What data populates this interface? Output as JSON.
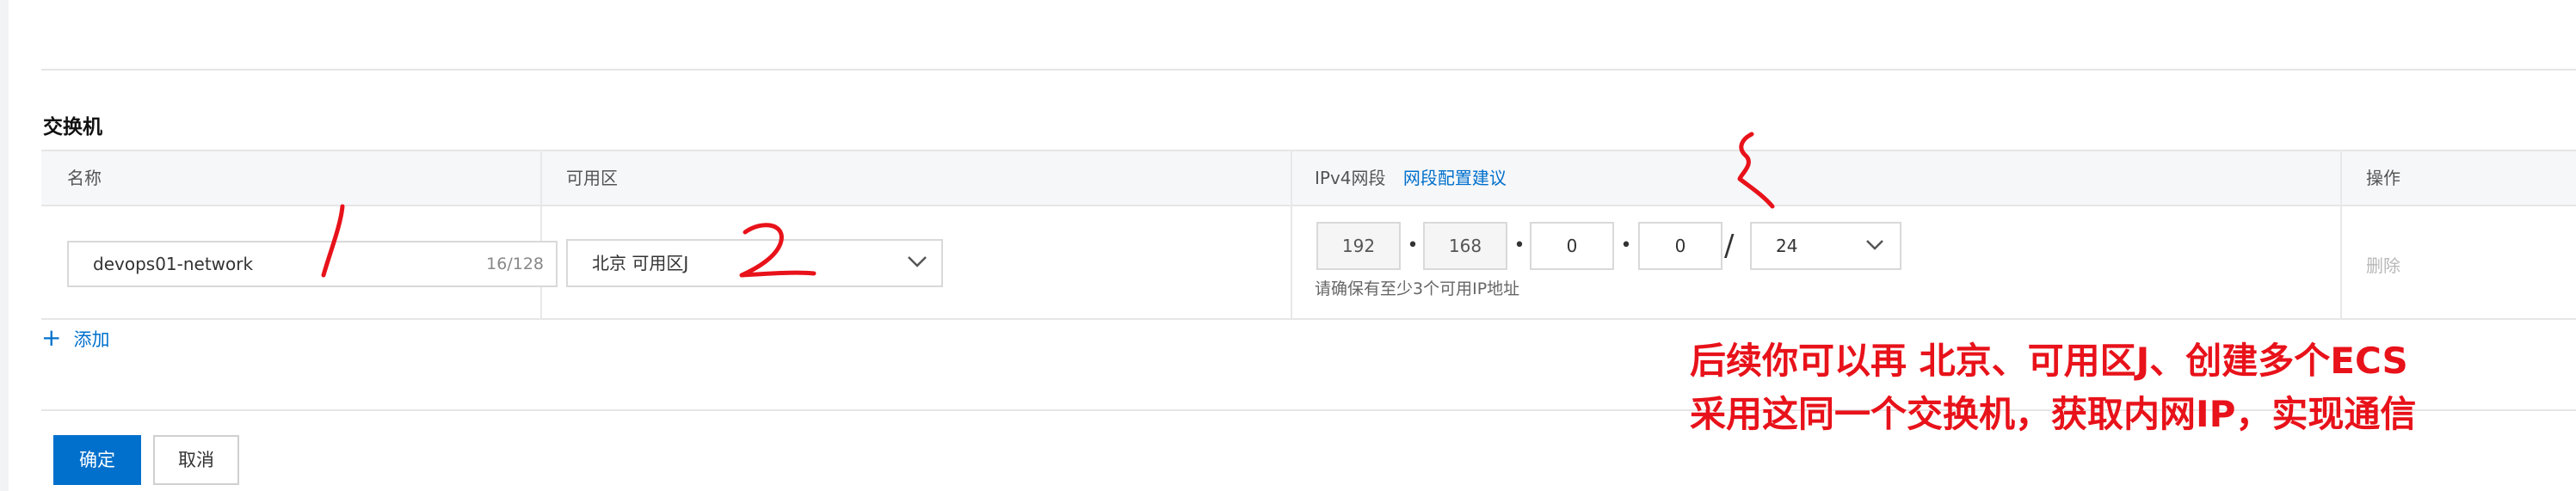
{
  "section_title": "交换机",
  "table": {
    "headers": {
      "name": "名称",
      "zone": "可用区",
      "ipv4": "IPv4网段",
      "ipv4_link": "网段配置建议",
      "action": "操作"
    },
    "row": {
      "name_value": "devops01-network",
      "name_count": "16/128",
      "zone_value": "北京 可用区J",
      "ip_octets": [
        "192",
        "168",
        "0",
        "0"
      ],
      "ip_dot": "•",
      "mask_slash": "/",
      "mask_value": "24",
      "ip_hint": "请确保有至少3个可用IP地址",
      "delete_label": "删除"
    }
  },
  "add_label": "添加",
  "buttons": {
    "confirm": "确定",
    "cancel": "取消"
  },
  "annotations": {
    "note_line1": "后续你可以再 北京、可用区J、创建多个ECS",
    "note_line2": "采用这同一个交换机，获取内网IP，实现通信",
    "color": "#e8121a"
  },
  "colors": {
    "link": "#0070cc",
    "primary": "#0070cc"
  }
}
